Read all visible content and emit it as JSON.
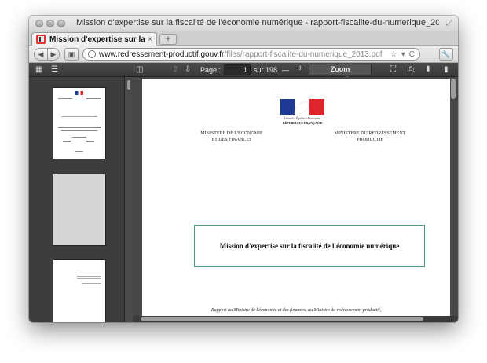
{
  "window": {
    "title": "Mission d'expertise sur la fiscalité de l'économie numérique - rapport-fiscalite-du-numerique_2013.pdf"
  },
  "tab": {
    "label": "Mission d'expertise sur la fiscal...",
    "close": "×",
    "new_tab": "+"
  },
  "navbar": {
    "url_domain": "www.redressement-productif.gouv.fr",
    "url_path": "/files/rapport-fiscalite-du-numerique_2013.pdf",
    "star": "☆",
    "dropdown": "▾",
    "reload": "C"
  },
  "pdf_toolbar": {
    "page_label": "Page :",
    "page_value": "1",
    "page_total": "sur 198",
    "zoom_out": "—",
    "zoom_in": "+",
    "zoom_value": "Zoom automatique"
  },
  "document": {
    "motto": "Liberté • Égalité • Fraternité",
    "republique": "RÉPUBLIQUE FRANÇAISE",
    "ministry_left_line1": "MINISTERE DE L'ECONOMIE",
    "ministry_left_line2": "ET DES FINANCES",
    "ministry_right_line1": "MINISTERE DU REDRESSEMENT",
    "ministry_right_line2": "PRODUCTIF",
    "mission_title": "Mission d'expertise sur la fiscalité de l'économie numérique",
    "report_text": "Rapport au Ministre de l'économie et des finances, au Ministre du redressement productif,"
  },
  "colors": {
    "flag_blue": "#1f3a93",
    "flag_red": "#e0242b",
    "mission_border": "#4a9a7a",
    "toolbar_bg": "#3f3f3f"
  }
}
